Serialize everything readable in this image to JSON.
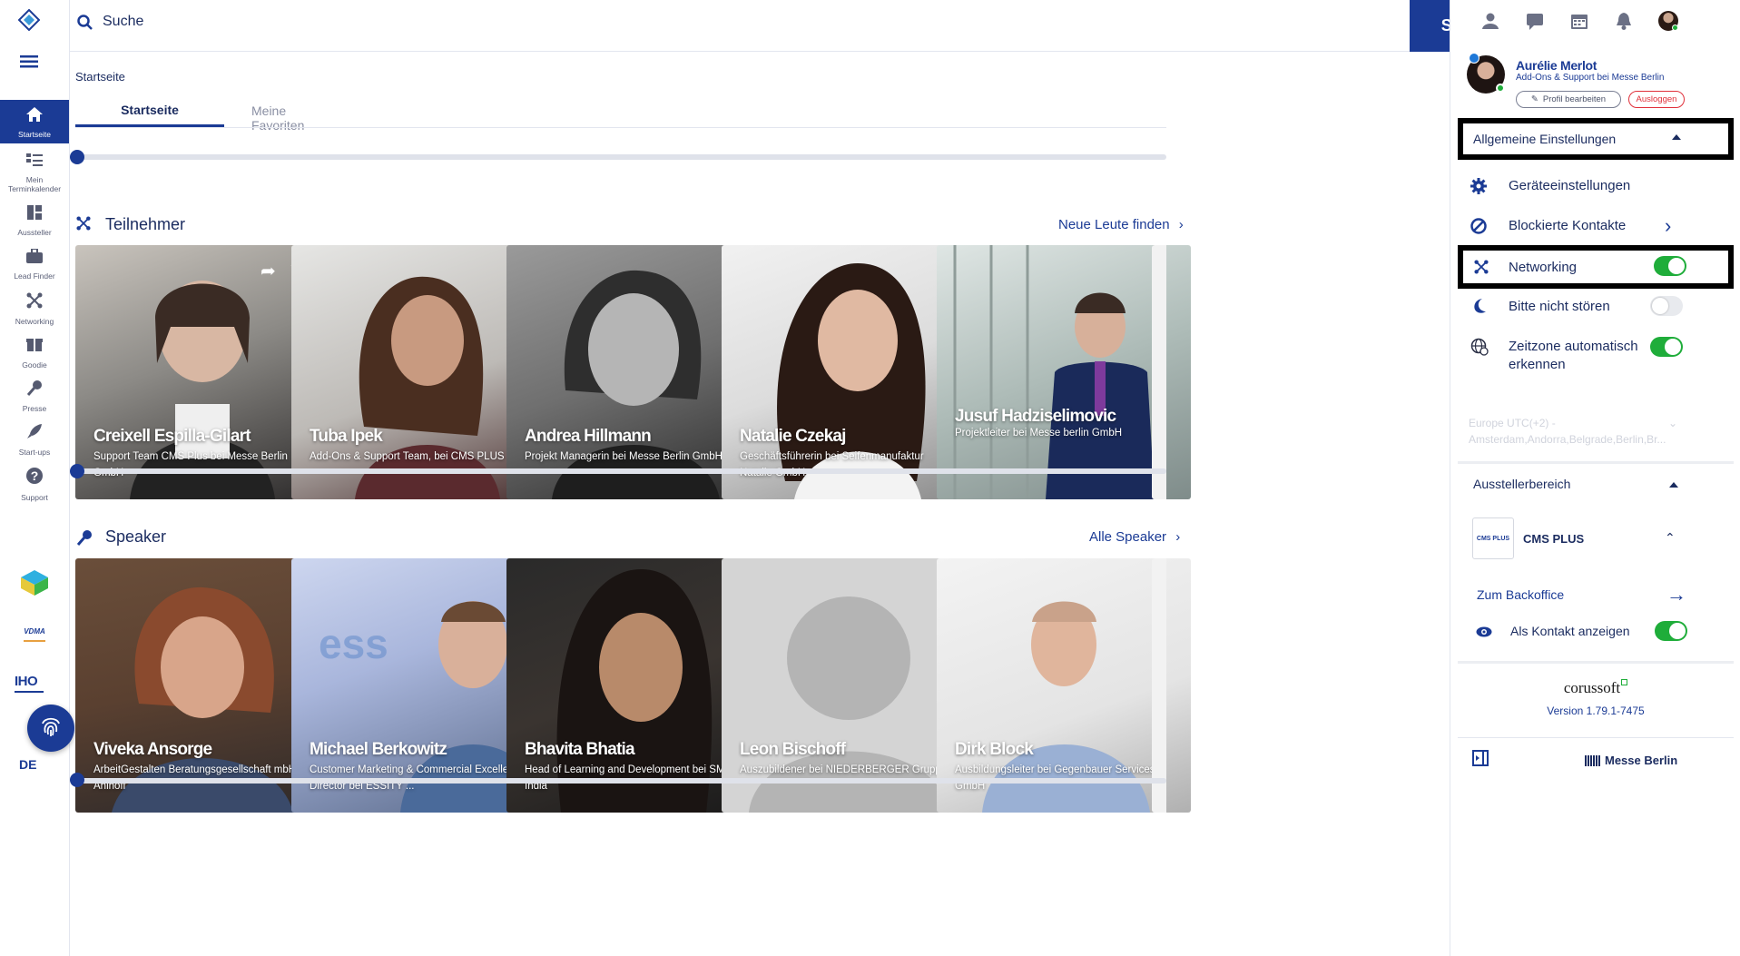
{
  "rail": {
    "items": [
      {
        "label": "Startseite",
        "icon": "home-icon"
      },
      {
        "label": "Mein Terminkalender",
        "icon": "calendar-list-icon"
      },
      {
        "label": "Aussteller",
        "icon": "exhibitor-icon"
      },
      {
        "label": "Lead Finder",
        "icon": "briefcase-icon"
      },
      {
        "label": "Networking",
        "icon": "network-icon"
      },
      {
        "label": "Goodie",
        "icon": "gift-icon"
      },
      {
        "label": "Presse",
        "icon": "microphone-icon"
      },
      {
        "label": "Start-ups",
        "icon": "rocket-icon"
      },
      {
        "label": "Support",
        "icon": "help-icon"
      }
    ],
    "partner_logo_1": "VDMA",
    "partner_logo_2": "IHO",
    "language": "DE"
  },
  "topbar": {
    "search_placeholder": "Suche",
    "search_button": "Suche"
  },
  "main": {
    "breadcrumb": "Startseite",
    "tabs": [
      {
        "label": "Startseite",
        "active": true
      },
      {
        "label": "Meine Favoriten",
        "active": false
      }
    ],
    "participants": {
      "title": "Teilnehmer",
      "link": "Neue Leute finden",
      "cards": [
        {
          "name": "Creixell Espilla-Gilart",
          "sub": "Support Team CMS Plus bei Messe Berlin GmbH"
        },
        {
          "name": "Tuba Ipek",
          "sub": "Add-Ons & Support Team, bei CMS PLUS"
        },
        {
          "name": "Andrea Hillmann",
          "sub": "Projekt Managerin bei Messe Berlin GmbH"
        },
        {
          "name": "Natalie Czekaj",
          "sub": "Geschäftsführerin bei Seifenmanufaktur Natalie GmbH"
        },
        {
          "name": "Jusuf Hadziselimovic",
          "sub": "Projektleiter bei Messe berlin GmbH"
        }
      ]
    },
    "speakers": {
      "title": "Speaker",
      "link": "Alle Speaker",
      "cards": [
        {
          "name": "Viveka Ansorge",
          "sub": "ArbeitGestalten Beratungsgesellschaft mbH, Ahlhoff"
        },
        {
          "name": "Michael Berkowitz",
          "sub": "Customer Marketing & Commercial Excellence Director bei ESSITY ..."
        },
        {
          "name": "Bhavita Bhatia",
          "sub": "Head of Learning and Development bei SMC India"
        },
        {
          "name": "Leon Bischoff",
          "sub": "Auszubildener bei NIEDERBERGER Gruppe"
        },
        {
          "name": "Dirk Block",
          "sub": "Ausbildungsleiter bei Gegenbauer Services GmbH"
        }
      ]
    }
  },
  "panel": {
    "user_name": "Aurélie Merlot",
    "user_role": "Add-Ons & Support bei Messe Berlin",
    "edit_profile": "Profil bearbeiten",
    "logout": "Ausloggen",
    "general_settings": "Allgemeine Einstellungen",
    "device_settings": "Geräteeinstellungen",
    "blocked_contacts": "Blockierte Kontakte",
    "networking": {
      "label": "Networking",
      "on": true
    },
    "dnd": {
      "label": "Bitte nicht stören",
      "on": false
    },
    "timezone_auto": {
      "label_1": "Zeitzone automatisch",
      "label_2": "erkennen",
      "on": true
    },
    "timezone_select_1": "Europe UTC(+2) -",
    "timezone_select_2": "Amsterdam,Andorra,Belgrade,Berlin,Br...",
    "exhibitor_area": "Ausstellerbereich",
    "company_logo": "CMS PLUS",
    "company_name": "CMS PLUS",
    "backoffice": "Zum Backoffice",
    "show_contact": {
      "label": "Als Kontakt anzeigen",
      "on": true
    },
    "brand": "corussoft",
    "version": "Version 1.79.1-7475",
    "footer_brand": "Messe Berlin"
  },
  "colors": {
    "primary": "#1b3b95",
    "toggle_on": "#1fad3a",
    "logout_red": "#e0303a"
  }
}
